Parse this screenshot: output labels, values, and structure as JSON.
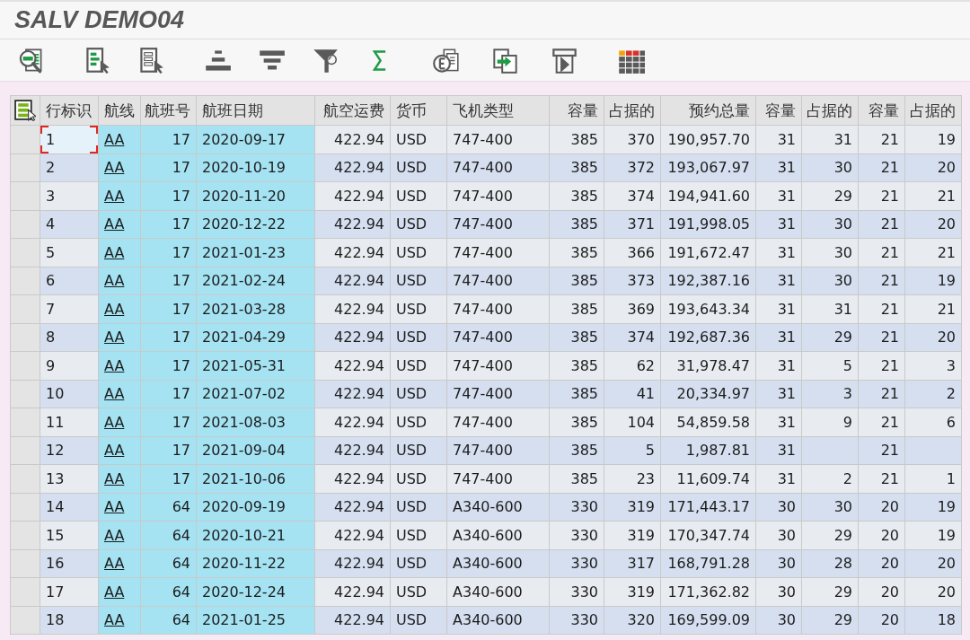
{
  "window": {
    "title": "SALV DEMO04"
  },
  "toolbar": [
    [
      {
        "kind": "details"
      }
    ],
    [
      {
        "kind": "select"
      },
      {
        "kind": "choose"
      }
    ],
    [
      {
        "kind": "ascending"
      },
      {
        "kind": "descending"
      },
      {
        "kind": "filter"
      },
      {
        "kind": "total"
      }
    ],
    [
      {
        "kind": "preview"
      },
      {
        "kind": "export"
      },
      {
        "kind": "layout"
      }
    ],
    [
      {
        "kind": "views"
      }
    ]
  ],
  "table": {
    "columns": [
      {
        "label": "行标识",
        "kind": "id"
      },
      {
        "label": "航线",
        "kind": "link"
      },
      {
        "label": "航班号",
        "kind": "keynum"
      },
      {
        "label": "航班日期",
        "kind": "key"
      },
      {
        "label": "航空运费",
        "kind": "number"
      },
      {
        "label": "货币",
        "kind": "text"
      },
      {
        "label": "飞机类型",
        "kind": "text"
      },
      {
        "label": "容量",
        "kind": "number"
      },
      {
        "label": "占据的",
        "kind": "number"
      },
      {
        "label": "预约总量",
        "kind": "number"
      },
      {
        "label": "容量",
        "kind": "number"
      },
      {
        "label": "占据的",
        "kind": "number"
      },
      {
        "label": "容量",
        "kind": "number"
      },
      {
        "label": "占据的",
        "kind": "number"
      }
    ],
    "rows": [
      {
        "selected": false,
        "focused": true,
        "cells": [
          "1",
          "AA",
          "17",
          "2020-09-17",
          "422.94",
          "USD",
          "747-400",
          "385",
          "370",
          "190,957.70",
          "31",
          "31",
          "21",
          "19"
        ]
      },
      {
        "selected": false,
        "focused": false,
        "cells": [
          "2",
          "AA",
          "17",
          "2020-10-19",
          "422.94",
          "USD",
          "747-400",
          "385",
          "372",
          "193,067.97",
          "31",
          "30",
          "21",
          "20"
        ]
      },
      {
        "selected": false,
        "focused": false,
        "cells": [
          "3",
          "AA",
          "17",
          "2020-11-20",
          "422.94",
          "USD",
          "747-400",
          "385",
          "374",
          "194,941.60",
          "31",
          "29",
          "21",
          "21"
        ]
      },
      {
        "selected": false,
        "focused": false,
        "cells": [
          "4",
          "AA",
          "17",
          "2020-12-22",
          "422.94",
          "USD",
          "747-400",
          "385",
          "371",
          "191,998.05",
          "31",
          "30",
          "21",
          "20"
        ]
      },
      {
        "selected": false,
        "focused": false,
        "cells": [
          "5",
          "AA",
          "17",
          "2021-01-23",
          "422.94",
          "USD",
          "747-400",
          "385",
          "366",
          "191,672.47",
          "31",
          "30",
          "21",
          "21"
        ]
      },
      {
        "selected": false,
        "focused": false,
        "cells": [
          "6",
          "AA",
          "17",
          "2021-02-24",
          "422.94",
          "USD",
          "747-400",
          "385",
          "373",
          "192,387.16",
          "31",
          "30",
          "21",
          "19"
        ]
      },
      {
        "selected": false,
        "focused": false,
        "cells": [
          "7",
          "AA",
          "17",
          "2021-03-28",
          "422.94",
          "USD",
          "747-400",
          "385",
          "369",
          "193,643.34",
          "31",
          "31",
          "21",
          "21"
        ]
      },
      {
        "selected": false,
        "focused": false,
        "cells": [
          "8",
          "AA",
          "17",
          "2021-04-29",
          "422.94",
          "USD",
          "747-400",
          "385",
          "374",
          "192,687.36",
          "31",
          "29",
          "21",
          "20"
        ]
      },
      {
        "selected": false,
        "focused": false,
        "cells": [
          "9",
          "AA",
          "17",
          "2021-05-31",
          "422.94",
          "USD",
          "747-400",
          "385",
          "62",
          "31,978.47",
          "31",
          "5",
          "21",
          "3"
        ]
      },
      {
        "selected": false,
        "focused": false,
        "cells": [
          "10",
          "AA",
          "17",
          "2021-07-02",
          "422.94",
          "USD",
          "747-400",
          "385",
          "41",
          "20,334.97",
          "31",
          "3",
          "21",
          "2"
        ]
      },
      {
        "selected": false,
        "focused": false,
        "cells": [
          "11",
          "AA",
          "17",
          "2021-08-03",
          "422.94",
          "USD",
          "747-400",
          "385",
          "104",
          "54,859.58",
          "31",
          "9",
          "21",
          "6"
        ]
      },
      {
        "selected": false,
        "focused": false,
        "cells": [
          "12",
          "AA",
          "17",
          "2021-09-04",
          "422.94",
          "USD",
          "747-400",
          "385",
          "5",
          "1,987.81",
          "31",
          null,
          "21",
          null
        ]
      },
      {
        "selected": false,
        "focused": false,
        "cells": [
          "13",
          "AA",
          "17",
          "2021-10-06",
          "422.94",
          "USD",
          "747-400",
          "385",
          "23",
          "11,609.74",
          "31",
          "2",
          "21",
          "1"
        ]
      },
      {
        "selected": false,
        "focused": false,
        "cells": [
          "14",
          "AA",
          "64",
          "2020-09-19",
          "422.94",
          "USD",
          "A340-600",
          "330",
          "319",
          "171,443.17",
          "30",
          "30",
          "20",
          "19"
        ]
      },
      {
        "selected": false,
        "focused": false,
        "cells": [
          "15",
          "AA",
          "64",
          "2020-10-21",
          "422.94",
          "USD",
          "A340-600",
          "330",
          "319",
          "170,347.74",
          "30",
          "29",
          "20",
          "19"
        ]
      },
      {
        "selected": false,
        "focused": false,
        "cells": [
          "16",
          "AA",
          "64",
          "2020-11-22",
          "422.94",
          "USD",
          "A340-600",
          "330",
          "317",
          "168,791.28",
          "30",
          "28",
          "20",
          "20"
        ]
      },
      {
        "selected": false,
        "focused": false,
        "cells": [
          "17",
          "AA",
          "64",
          "2020-12-24",
          "422.94",
          "USD",
          "A340-600",
          "330",
          "319",
          "171,362.82",
          "30",
          "29",
          "20",
          "20"
        ]
      },
      {
        "selected": false,
        "focused": false,
        "cells": [
          "18",
          "AA",
          "64",
          "2021-01-25",
          "422.94",
          "USD",
          "A340-600",
          "330",
          "320",
          "169,599.09",
          "30",
          "29",
          "20",
          "18"
        ]
      }
    ]
  }
}
